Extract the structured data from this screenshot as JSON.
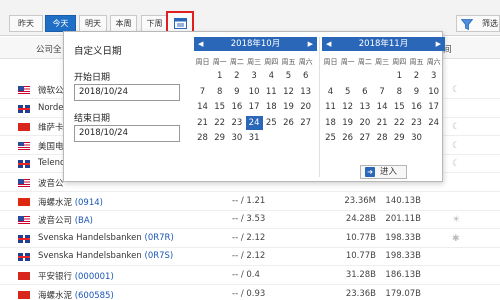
{
  "toolbar": {
    "tabs": [
      "昨天",
      "今天",
      "明天",
      "本周",
      "下周"
    ],
    "filter_label": "筛选"
  },
  "table": {
    "header_company": "公司全",
    "header_right": "间",
    "rows": [
      {
        "flag": "us",
        "name": "微软公",
        "code": "",
        "c1": "",
        "c2": "",
        "c3": "",
        "icon": "☾"
      },
      {
        "flag": "gb",
        "name": "Nordea",
        "code": "",
        "c1": "",
        "c2": "",
        "c3": "",
        "icon": ""
      },
      {
        "flag": "cn",
        "name": "维萨卡",
        "code": "",
        "c1": "",
        "c2": "",
        "c3": "",
        "icon": "☾"
      },
      {
        "flag": "us",
        "name": "美国电",
        "code": "",
        "c1": "",
        "c2": "",
        "c3": "",
        "icon": "☾"
      },
      {
        "flag": "gb",
        "name": "Telenor",
        "code": "",
        "c1": "",
        "c2": "",
        "c3": "",
        "icon": "☾"
      },
      {
        "flag": "us",
        "name": "波音公",
        "code": "",
        "c1": "",
        "c2": "",
        "c3": "",
        "icon": ""
      },
      {
        "flag": "hk",
        "name": "海螺水泥 ",
        "code": "(0914)",
        "c1": "-- / 1.21",
        "c2": "23.36M",
        "c3": "140.13B",
        "icon": ""
      },
      {
        "flag": "us",
        "name": "波音公司 ",
        "code": "(BA)",
        "c1": "-- / 3.53",
        "c2": "24.28B",
        "c3": "201.11B",
        "icon": "☀"
      },
      {
        "flag": "gb",
        "name": "Svenska Handelsbanken ",
        "code": "(0R7R)",
        "c1": "-- / 2.12",
        "c2": "10.77B",
        "c3": "198.33B",
        "icon": "✱"
      },
      {
        "flag": "gb",
        "name": "Svenska Handelsbanken ",
        "code": "(0R7S)",
        "c1": "-- / 2.12",
        "c2": "10.77B",
        "c3": "198.33B",
        "icon": ""
      },
      {
        "flag": "cn",
        "name": "平安银行 ",
        "code": "(000001)",
        "c1": "-- / 0.4",
        "c2": "31.28B",
        "c3": "186.13B",
        "icon": ""
      },
      {
        "flag": "cn",
        "name": "海螺水泥 ",
        "code": "(600585)",
        "c1": "-- / 0.93",
        "c2": "23.36B",
        "c3": "179.07B",
        "icon": ""
      }
    ]
  },
  "popup": {
    "title": "自定义日期",
    "start_label": "开始日期",
    "start_value": "2018/10/24",
    "end_label": "结束日期",
    "end_value": "2018/10/24",
    "enter_label": "进入",
    "weekdays": [
      "周日",
      "周一",
      "周二",
      "周三",
      "周四",
      "周五",
      "周六"
    ],
    "months": [
      {
        "title": "2018年10月",
        "selected": "24",
        "weeks": [
          [
            "",
            "1",
            "2",
            "3",
            "4",
            "5",
            "6"
          ],
          [
            "7",
            "8",
            "9",
            "10",
            "11",
            "12",
            "13"
          ],
          [
            "14",
            "15",
            "16",
            "17",
            "18",
            "19",
            "20"
          ],
          [
            "21",
            "22",
            "23",
            "24",
            "25",
            "26",
            "27"
          ],
          [
            "28",
            "29",
            "30",
            "31",
            "",
            "",
            ""
          ]
        ]
      },
      {
        "title": "2018年11月",
        "selected": "",
        "weeks": [
          [
            "",
            "",
            "",
            "",
            "1",
            "2",
            "3"
          ],
          [
            "4",
            "5",
            "6",
            "7",
            "8",
            "9",
            "10"
          ],
          [
            "11",
            "12",
            "13",
            "14",
            "15",
            "16",
            "17"
          ],
          [
            "18",
            "19",
            "20",
            "21",
            "22",
            "23",
            "24"
          ],
          [
            "25",
            "26",
            "27",
            "28",
            "29",
            "30",
            ""
          ]
        ]
      }
    ]
  },
  "colors": {
    "accent": "#2b67b9",
    "highlight_border": "#e02020"
  }
}
